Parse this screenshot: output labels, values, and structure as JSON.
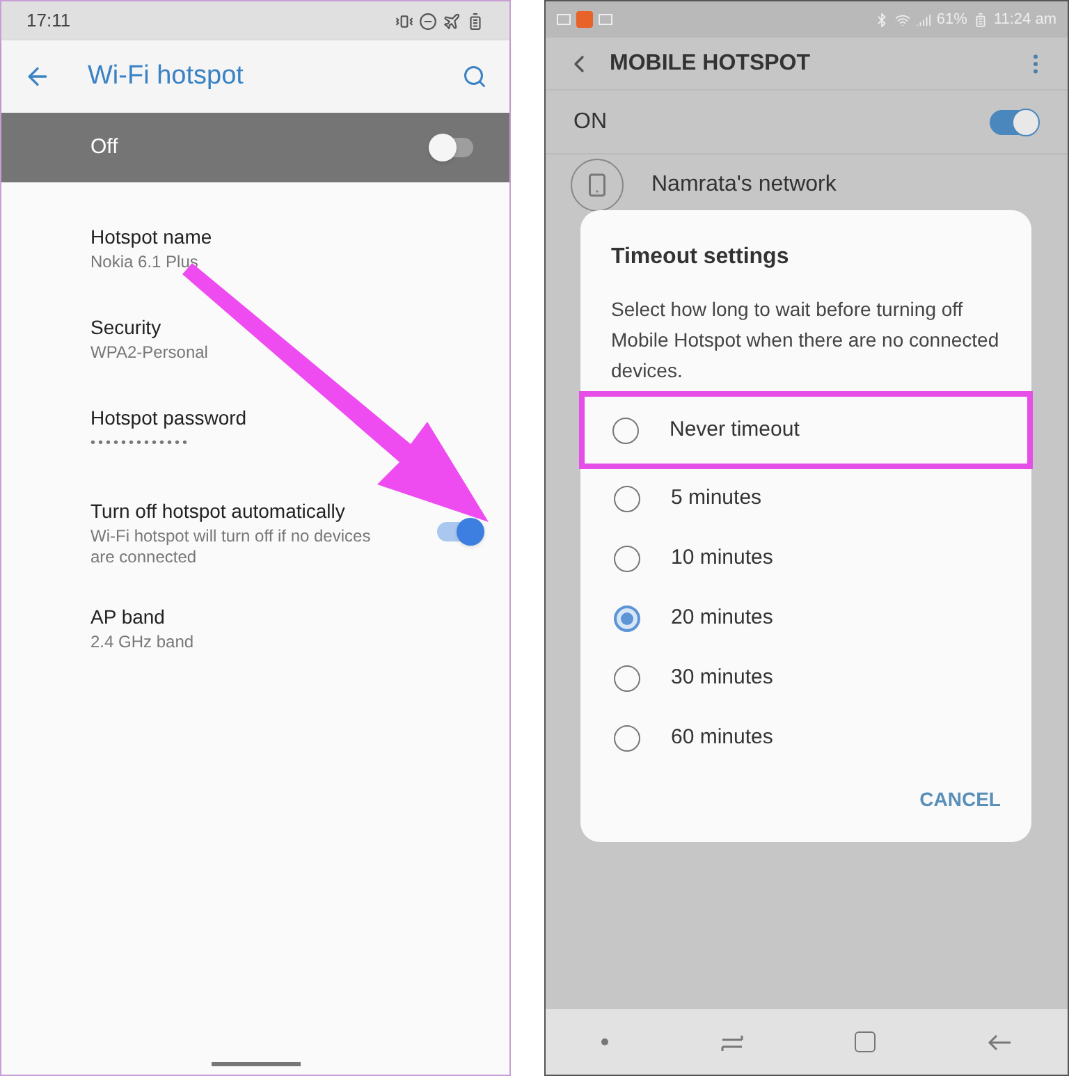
{
  "left_phone": {
    "status_bar": {
      "time": "17:11"
    },
    "app_bar": {
      "title": "Wi-Fi hotspot"
    },
    "master_switch": {
      "label": "Off",
      "on": false
    },
    "settings": [
      {
        "kind": "text",
        "title": "Hotspot name",
        "subtitle": "Nokia 6.1 Plus"
      },
      {
        "kind": "text",
        "title": "Security",
        "subtitle": "WPA2-Personal"
      },
      {
        "kind": "password",
        "title": "Hotspot password",
        "subtitle": "•••••••••••••"
      },
      {
        "kind": "switch",
        "title": "Turn off hotspot automatically",
        "subtitle": "Wi-Fi hotspot will turn off if no devices are connected",
        "on": true
      },
      {
        "kind": "text",
        "title": "AP band",
        "subtitle": "2.4 GHz band"
      }
    ]
  },
  "right_phone": {
    "status_bar": {
      "battery": "61%",
      "time": "11:24 am"
    },
    "app_bar": {
      "title": "MOBILE HOTSPOT"
    },
    "master_switch": {
      "label": "ON",
      "on": true
    },
    "network": {
      "name": "Namrata's network"
    },
    "dialog": {
      "title": "Timeout settings",
      "message": "Select how long to wait before turning off Mobile Hotspot when there are no connected devices.",
      "options": [
        {
          "label": "Never timeout",
          "selected": false,
          "highlighted": true
        },
        {
          "label": "5 minutes",
          "selected": false,
          "highlighted": false
        },
        {
          "label": "10 minutes",
          "selected": false,
          "highlighted": false
        },
        {
          "label": "20 minutes",
          "selected": true,
          "highlighted": false
        },
        {
          "label": "30 minutes",
          "selected": false,
          "highlighted": false
        },
        {
          "label": "60 minutes",
          "selected": false,
          "highlighted": false
        }
      ],
      "cancel": "CANCEL"
    }
  }
}
